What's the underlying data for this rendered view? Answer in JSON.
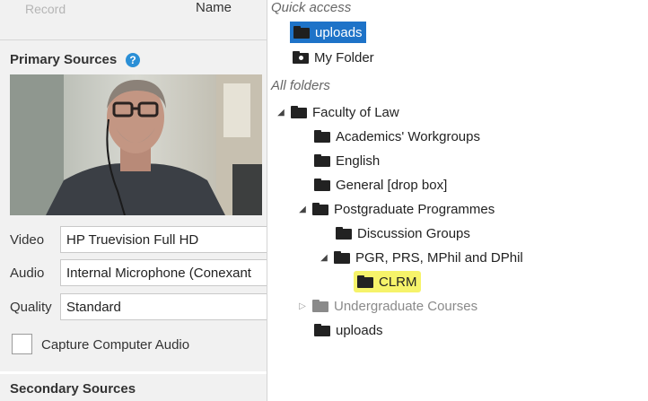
{
  "left": {
    "record_label": "Record",
    "name_label": "Name",
    "primary_title": "Primary Sources",
    "help_icon": "?",
    "fields": {
      "video": {
        "label": "Video",
        "value": "HP Truevision Full HD"
      },
      "audio": {
        "label": "Audio",
        "value": "Internal Microphone (Conexant"
      },
      "quality": {
        "label": "Quality",
        "value": "Standard"
      }
    },
    "capture_audio_label": "Capture Computer Audio",
    "secondary_title": "Secondary Sources"
  },
  "tree": {
    "quick_access_label": "Quick access",
    "all_folders_label": "All folders",
    "quick_items": [
      {
        "label": "uploads",
        "icon": "folder-icon"
      },
      {
        "label": "My Folder",
        "icon": "my-folder-icon"
      }
    ],
    "folders": [
      {
        "label": "Faculty of Law",
        "expander": "◢"
      },
      {
        "label": "Academics' Workgroups"
      },
      {
        "label": "English"
      },
      {
        "label": "General [drop box]"
      },
      {
        "label": "Postgraduate Programmes",
        "expander": "◢"
      },
      {
        "label": "Discussion Groups"
      },
      {
        "label": "PGR, PRS, MPhil and DPhil",
        "expander": "◢"
      },
      {
        "label": "CLRM"
      },
      {
        "label": "Undergraduate Courses",
        "expander": "▷"
      },
      {
        "label": "uploads"
      }
    ]
  },
  "colors": {
    "selection": "#1e73c8",
    "highlight": "#f6f36a",
    "help_icon": "#2b8fd6"
  }
}
